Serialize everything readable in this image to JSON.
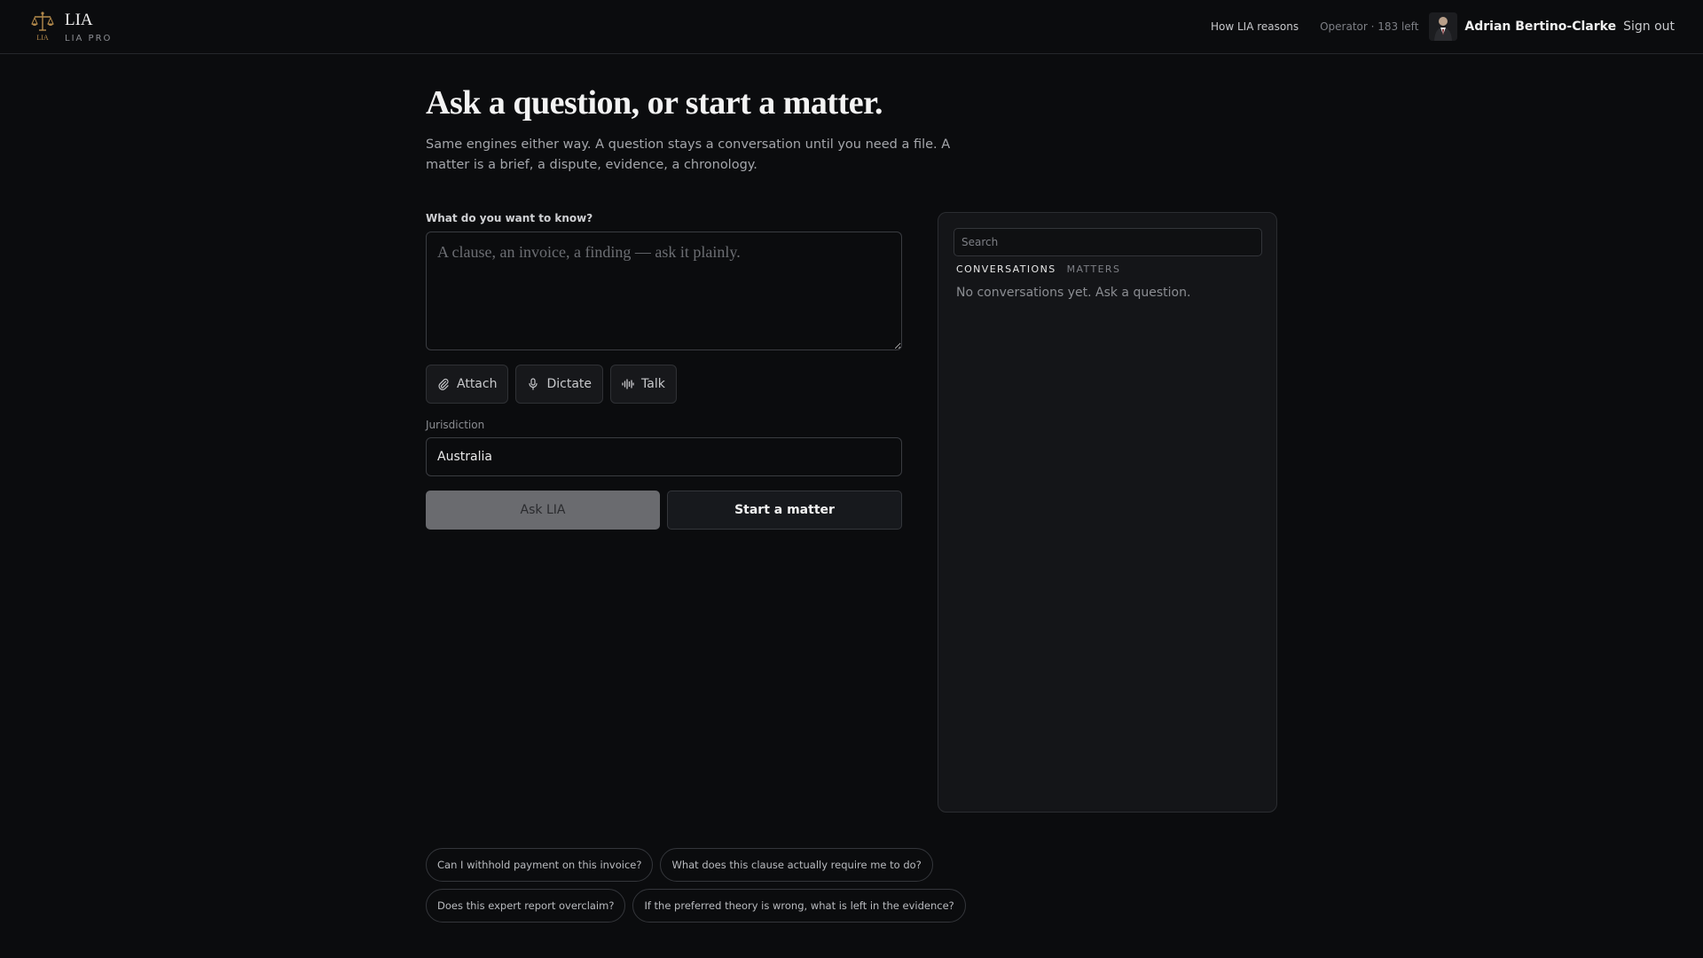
{
  "header": {
    "brand_name": "LIA",
    "brand_tier": "LIA PRO",
    "brand_mark_text": "LIA",
    "how_link": "How LIA reasons",
    "quota": "Operator · 183 left",
    "user_name": "Adrian Bertino-Clarke",
    "sign_out": "Sign out"
  },
  "main": {
    "title": "Ask a question, or start a matter.",
    "intro": "Same engines either way. A question stays a conversation until you need a file. A matter is a brief, a dispute, evidence, a chronology.",
    "question_label": "What do you want to know?",
    "question_placeholder": "A clause, an invoice, a finding — ask it plainly.",
    "tools": {
      "attach": "Attach",
      "dictate": "Dictate",
      "talk": "Talk"
    },
    "jurisdiction_label": "Jurisdiction",
    "jurisdiction_value": "Australia",
    "ask_button": "Ask LIA",
    "matter_button": "Start a matter"
  },
  "panel": {
    "search_placeholder": "Search",
    "tabs": [
      "CONVERSATIONS",
      "MATTERS"
    ],
    "empty_text": "No conversations yet. Ask a question."
  },
  "suggestions": [
    "Can I withhold payment on this invoice?",
    "What does this clause actually require me to do?",
    "Does this expert report overclaim?",
    "If the preferred theory is wrong, what is left in the evidence?"
  ],
  "colors": {
    "background": "#0b0c0e",
    "accent_gold": "#b58b4c"
  }
}
